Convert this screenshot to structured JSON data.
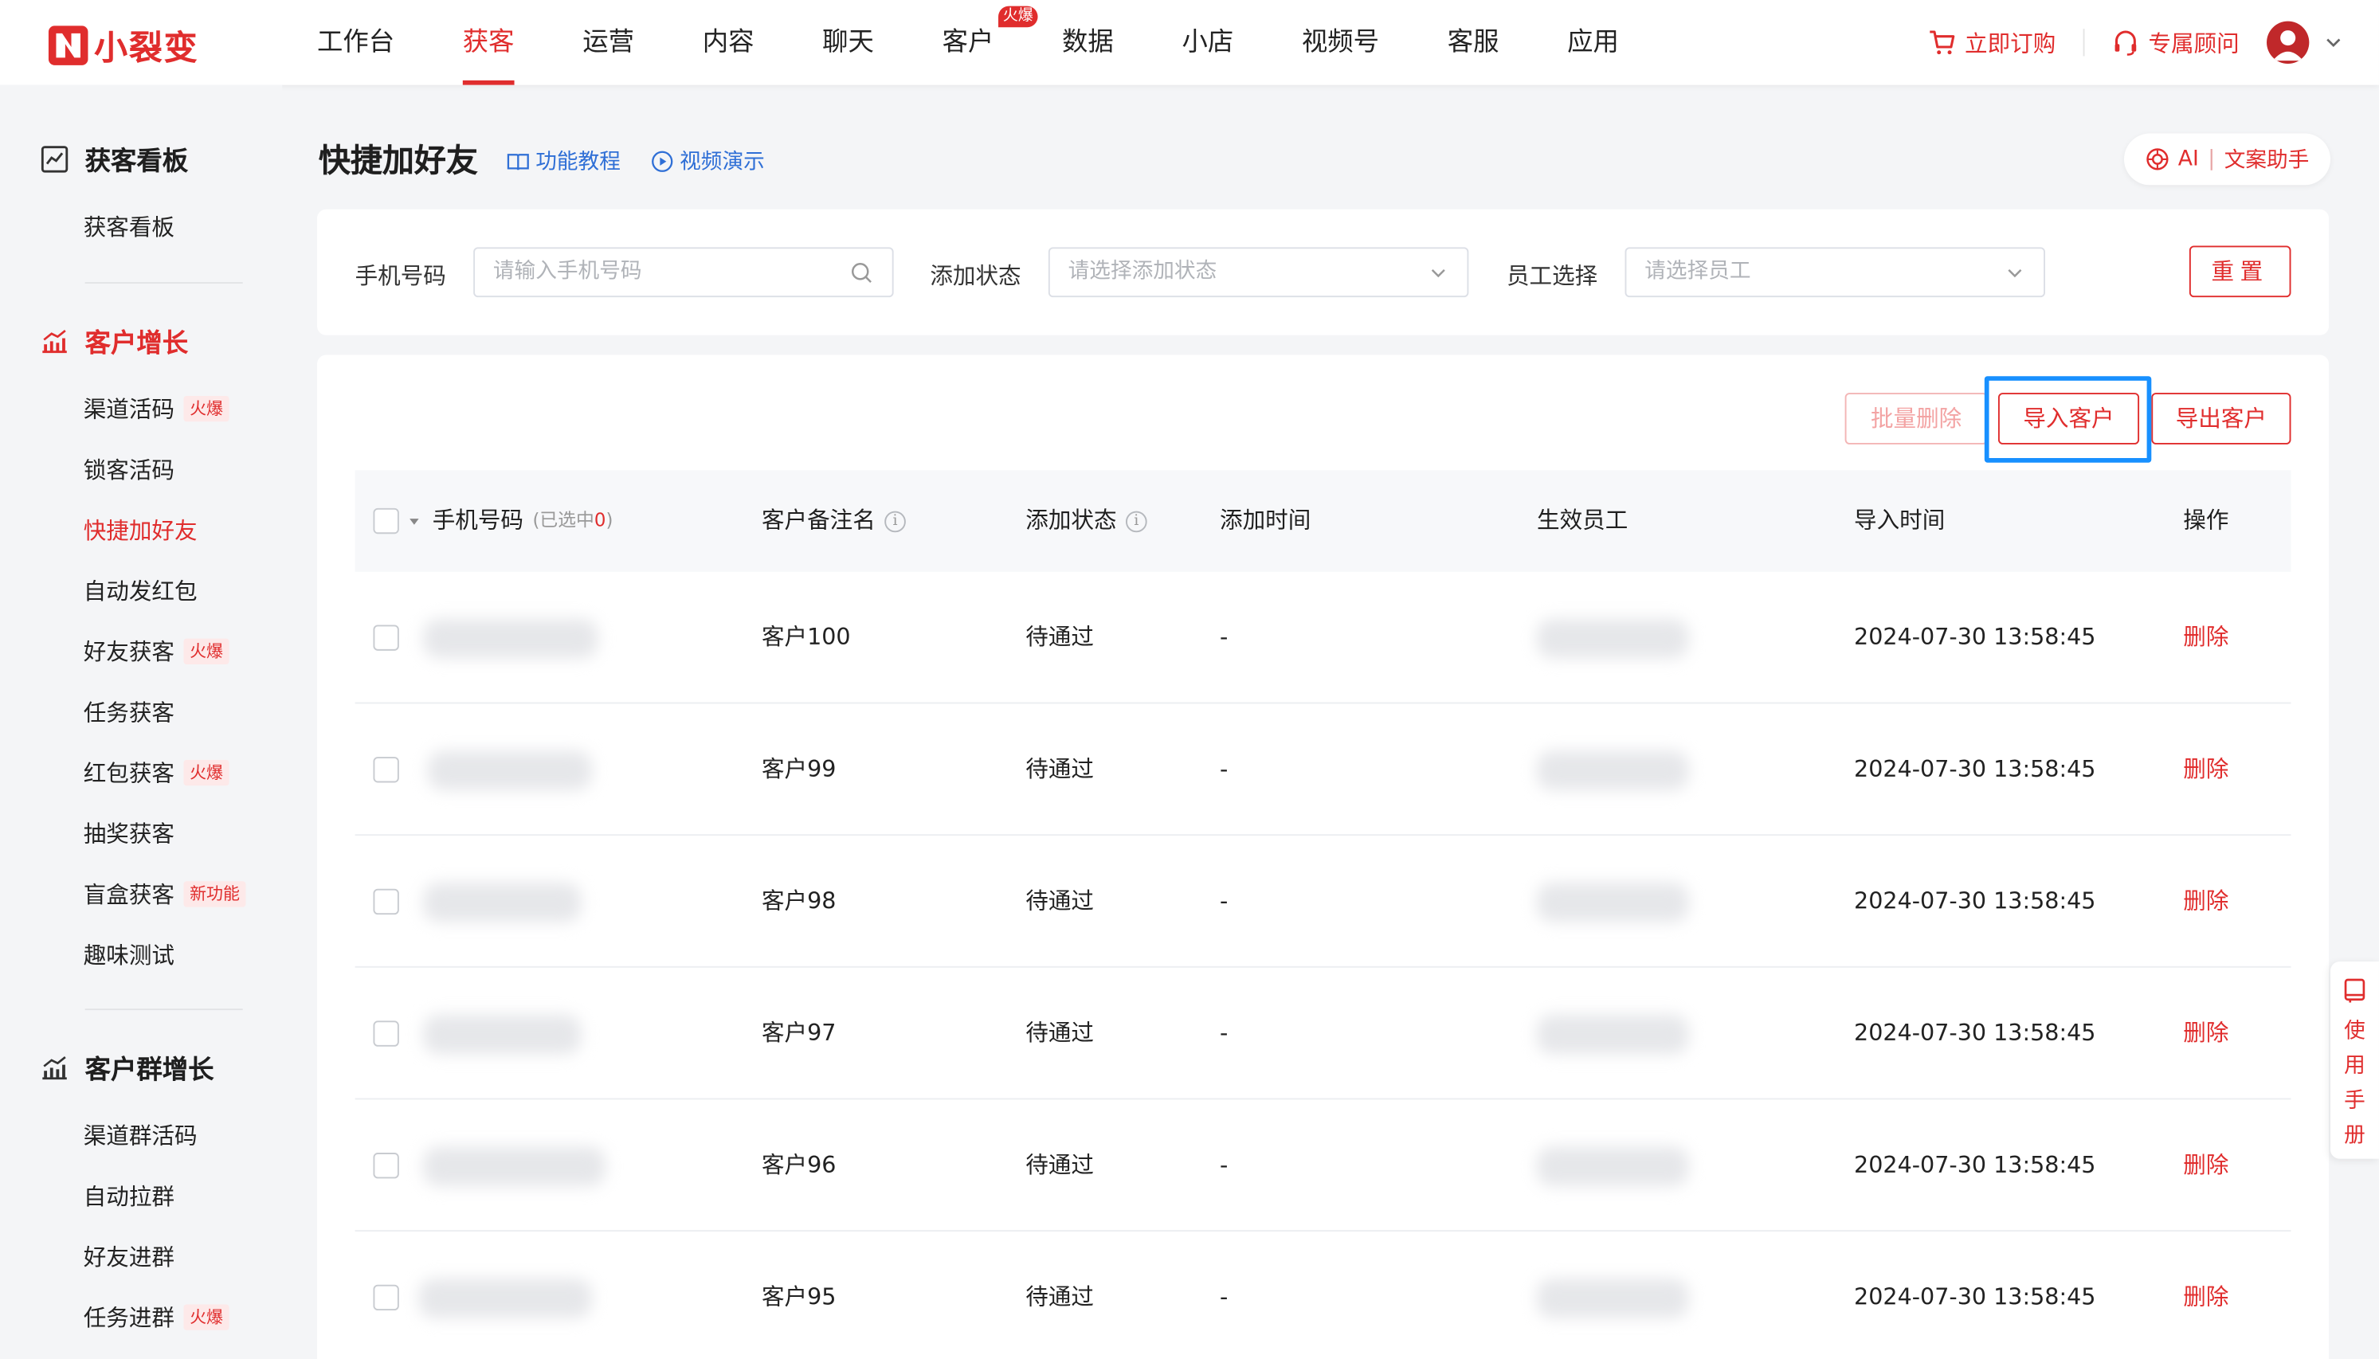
{
  "brand": {
    "name": "小裂变"
  },
  "nav": {
    "items": [
      {
        "label": "工作台"
      },
      {
        "label": "获客",
        "active": true
      },
      {
        "label": "运营"
      },
      {
        "label": "内容"
      },
      {
        "label": "聊天"
      },
      {
        "label": "客户",
        "badge": "火爆"
      },
      {
        "label": "数据"
      },
      {
        "label": "小店"
      },
      {
        "label": "视频号"
      },
      {
        "label": "客服"
      },
      {
        "label": "应用"
      }
    ],
    "order_label": "立即订购",
    "advisor_label": "专属顾问"
  },
  "sidebar": {
    "group1": {
      "title": "获客看板",
      "items": [
        "获客看板"
      ]
    },
    "group2": {
      "title": "客户增长",
      "items": [
        {
          "label": "渠道活码",
          "tag": "火爆"
        },
        {
          "label": "锁客活码"
        },
        {
          "label": "快捷加好友",
          "active": true
        },
        {
          "label": "自动发红包"
        },
        {
          "label": "好友获客",
          "tag": "火爆"
        },
        {
          "label": "任务获客"
        },
        {
          "label": "红包获客",
          "tag": "火爆"
        },
        {
          "label": "抽奖获客"
        },
        {
          "label": "盲盒获客",
          "tag": "新功能"
        },
        {
          "label": "趣味测试"
        }
      ]
    },
    "group3": {
      "title": "客户群增长",
      "items": [
        {
          "label": "渠道群活码"
        },
        {
          "label": "自动拉群"
        },
        {
          "label": "好友进群"
        },
        {
          "label": "任务进群",
          "tag": "火爆"
        }
      ]
    }
  },
  "page": {
    "title": "快捷加好友",
    "tutorial": "功能教程",
    "video": "视频演示",
    "ai_label": "AI",
    "ai_helper": "文案助手"
  },
  "filters": {
    "phone_label": "手机号码",
    "phone_placeholder": "请输入手机号码",
    "status_label": "添加状态",
    "status_placeholder": "请选择添加状态",
    "staff_label": "员工选择",
    "staff_placeholder": "请选择员工",
    "reset": "重置"
  },
  "toolbar": {
    "batch_delete": "批量删除",
    "import": "导入客户",
    "export": "导出客户"
  },
  "table": {
    "headers": {
      "phone": "手机号码",
      "selected_prefix": "(已选中",
      "selected_count": "0",
      "selected_suffix": ")",
      "remark": "客户备注名",
      "status": "添加状态",
      "add_time": "添加时间",
      "staff": "生效员工",
      "import_time": "导入时间",
      "action": "操作"
    },
    "rows": [
      {
        "remark": "客户100",
        "status": "待通过",
        "add_time": "-",
        "import_time": "2024-07-30 13:58:45",
        "action": "删除"
      },
      {
        "remark": "客户99",
        "status": "待通过",
        "add_time": "-",
        "import_time": "2024-07-30 13:58:45",
        "action": "删除"
      },
      {
        "remark": "客户98",
        "status": "待通过",
        "add_time": "-",
        "import_time": "2024-07-30 13:58:45",
        "action": "删除"
      },
      {
        "remark": "客户97",
        "status": "待通过",
        "add_time": "-",
        "import_time": "2024-07-30 13:58:45",
        "action": "删除"
      },
      {
        "remark": "客户96",
        "status": "待通过",
        "add_time": "-",
        "import_time": "2024-07-30 13:58:45",
        "action": "删除"
      },
      {
        "remark": "客户95",
        "status": "待通过",
        "add_time": "-",
        "import_time": "2024-07-30 13:58:45",
        "action": "删除"
      }
    ]
  },
  "manual": {
    "chars": [
      "使",
      "用",
      "手",
      "册"
    ]
  },
  "colors": {
    "brand": "#e02d2d",
    "link": "#2f6fd6",
    "highlight": "#1890ff"
  }
}
